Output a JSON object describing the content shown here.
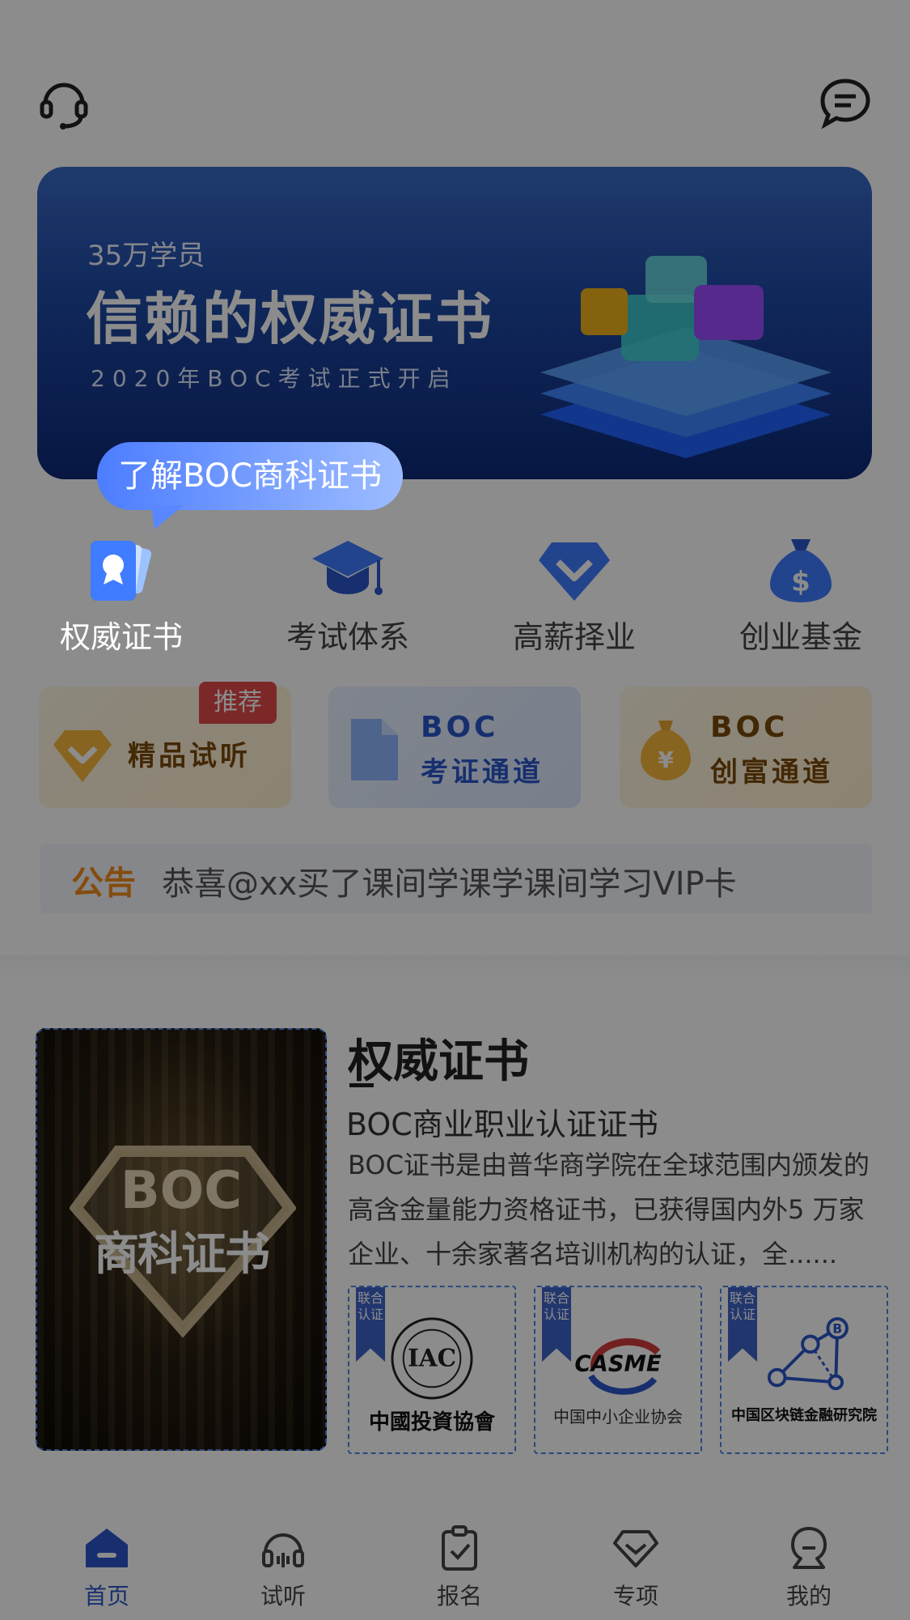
{
  "header": {
    "left_icon": "headset-icon",
    "right_icon": "chat-icon"
  },
  "banner": {
    "subtitle": "35万学员",
    "title": "信赖的权威证书",
    "tagline": "2020年BOC考试正式开启"
  },
  "tooltip": {
    "text": "了解BOC商科证书"
  },
  "quick_nav": [
    {
      "label": "权威证书",
      "icon": "certificate-icon"
    },
    {
      "label": "考试体系",
      "icon": "graduation-cap-icon"
    },
    {
      "label": "高薪择业",
      "icon": "diamond-icon"
    },
    {
      "label": "创业基金",
      "icon": "money-bag-icon"
    }
  ],
  "cards": [
    {
      "label": "精品试听",
      "badge": "推荐",
      "icon": "diamond-icon"
    },
    {
      "label_line1": "BOC",
      "label_line2": "考证通道",
      "icon": "document-icon"
    },
    {
      "label_line1": "BOC",
      "label_line2": "创富通道",
      "icon": "money-bag-icon"
    }
  ],
  "notice": {
    "tag": "公告",
    "text": "恭喜@xx买了课间学课学课间学习VIP卡"
  },
  "cert_section": {
    "poster_text_top": "BOC",
    "poster_text_bottom": "商科证书",
    "title": "权威证书",
    "subtitle": "BOC商业职业认证证书",
    "description": "BOC证书是由普华商学院在全球范围内颁发的高含金量能力资格证书，已获得国内外5 万家企业、十余家著名培训机构的认证，全......",
    "partners": [
      {
        "ribbon": "联合认证",
        "logo_text": "IAC",
        "name": "中國投資協會"
      },
      {
        "ribbon": "联合认证",
        "logo_text": "CASME",
        "name": "中国中小企业协会"
      },
      {
        "ribbon": "联合认证",
        "logo_text": "B",
        "name": "中国区块链金融研究院"
      }
    ]
  },
  "tabbar": [
    {
      "label": "首页",
      "icon": "home-icon",
      "active": true
    },
    {
      "label": "试听",
      "icon": "headphones-icon",
      "active": false
    },
    {
      "label": "报名",
      "icon": "clipboard-icon",
      "active": false
    },
    {
      "label": "专项",
      "icon": "diamond-icon",
      "active": false
    },
    {
      "label": "我的",
      "icon": "profile-icon",
      "active": false
    }
  ],
  "colors": {
    "accent": "#2b56c8",
    "notice_tag": "#f08a1d",
    "badge": "#e24a4a"
  }
}
